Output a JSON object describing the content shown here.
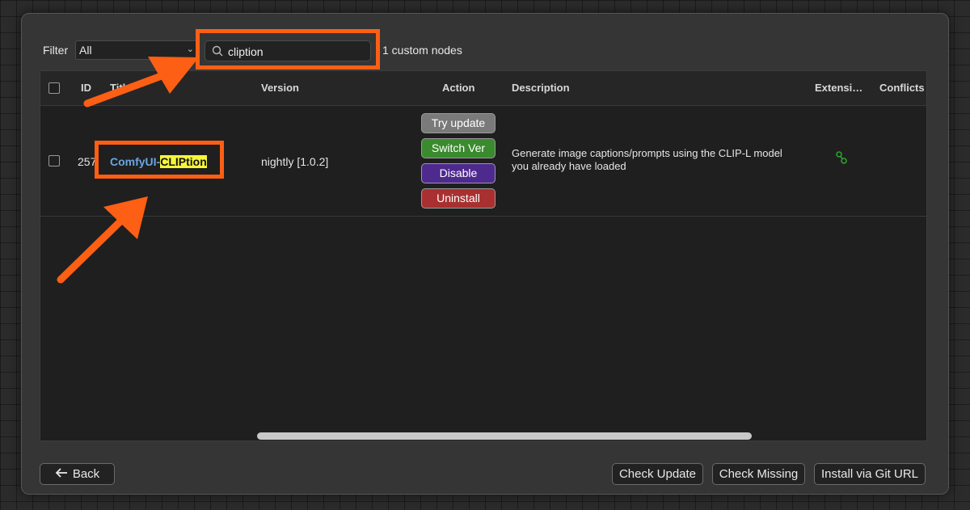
{
  "toolbar": {
    "filter_label": "Filter",
    "filter_value": "All",
    "search_value": "cliption",
    "node_count": "1 custom nodes"
  },
  "table": {
    "headers": {
      "id": "ID",
      "title": "Title",
      "version": "Version",
      "action": "Action",
      "description": "Description",
      "extensions": "Extensi…",
      "conflicts": "Conflicts"
    },
    "rows": [
      {
        "id": "257",
        "title_prefix": "ComfyUI-",
        "title_match": "CLIPtion",
        "version": "nightly [1.0.2]",
        "actions": {
          "try_update": "Try update",
          "switch_ver": "Switch Ver",
          "disable": "Disable",
          "uninstall": "Uninstall"
        },
        "description_line1": "Generate image captions/prompts using the CLIP-L model",
        "description_line2": "you already have loaded",
        "extension_icon": "node-link-icon"
      }
    ]
  },
  "footer": {
    "back": "Back",
    "check_update": "Check Update",
    "check_missing": "Check Missing",
    "install_git": "Install via Git URL"
  },
  "colors": {
    "annotation": "#fd5f14",
    "title_link": "#6aa6e6",
    "highlight": "#f5f53a",
    "btn_try_update": "#7a7a7a",
    "btn_switch_ver": "#3a8a2e",
    "btn_disable": "#4e2a8e",
    "btn_uninstall": "#a83030"
  }
}
